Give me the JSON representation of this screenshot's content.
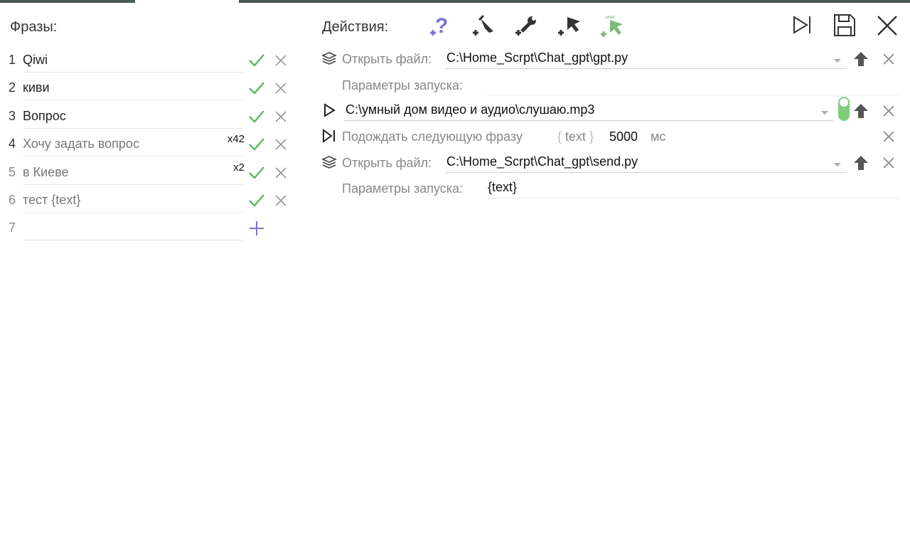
{
  "phrases": {
    "title": "Фразы:",
    "items": [
      {
        "num": "1",
        "text": "Qiwi",
        "count": ""
      },
      {
        "num": "2",
        "text": "киви",
        "count": ""
      },
      {
        "num": "3",
        "text": "Вопрос",
        "count": ""
      },
      {
        "num": "4",
        "text": "Хочу задать вопрос",
        "count": "x42"
      },
      {
        "num": "5",
        "text": "в Киеве",
        "count": "x2"
      },
      {
        "num": "6",
        "text": "тест {text}",
        "count": ""
      },
      {
        "num": "7",
        "text": "",
        "count": ""
      }
    ]
  },
  "actions": {
    "title": "Действия:",
    "toolbar_icons": [
      "add-question-icon",
      "add-move-cursor-icon",
      "add-wrench-icon",
      "add-cursor-icon",
      "add-web-cursor-icon"
    ],
    "window_icons": [
      "run-step-icon",
      "save-icon",
      "close-icon"
    ],
    "rows": {
      "open1": {
        "label": "Открыть файл:",
        "value": "C:\\Home_Scrpt\\Chat_gpt\\gpt.py"
      },
      "params1": {
        "label": "Параметры запуска:",
        "value": ""
      },
      "play": {
        "value": "C:\\умный дом видео и аудио\\слушаю.mp3"
      },
      "wait": {
        "label": "Подождать следующую фразу",
        "var": "text",
        "ms": "5000",
        "unit": "мс"
      },
      "open2": {
        "label": "Открыть файл:",
        "value": "C:\\Home_Scrpt\\Chat_gpt\\send.py"
      },
      "params2": {
        "label": "Параметры запуска:",
        "value": "{text}"
      }
    }
  },
  "colors": {
    "check": "#5cb85c",
    "accent_purple": "#7b72d1",
    "toggle_green": "#7dcf7d",
    "top_bar": "#4a5a52"
  }
}
